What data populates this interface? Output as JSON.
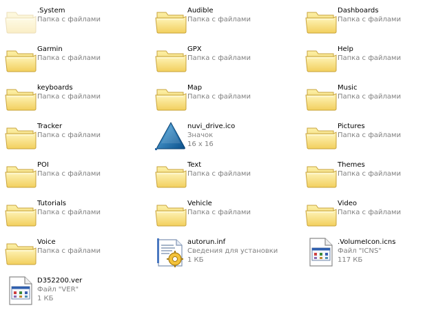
{
  "file_type_folder": "Папка с файлами",
  "items": [
    {
      "name": ".System",
      "icon": "folder-icon",
      "hidden": true,
      "lines": []
    },
    {
      "name": "Audible",
      "icon": "folder-icon",
      "lines": []
    },
    {
      "name": "Dashboards",
      "icon": "folder-icon",
      "lines": []
    },
    {
      "name": "Garmin",
      "icon": "folder-icon",
      "lines": []
    },
    {
      "name": "GPX",
      "icon": "folder-icon",
      "lines": []
    },
    {
      "name": "Help",
      "icon": "folder-icon",
      "lines": []
    },
    {
      "name": "keyboards",
      "icon": "folder-icon",
      "lines": []
    },
    {
      "name": "Map",
      "icon": "folder-icon",
      "lines": []
    },
    {
      "name": "Music",
      "icon": "folder-icon",
      "lines": []
    },
    {
      "name": "Tracker",
      "icon": "folder-icon",
      "lines": []
    },
    {
      "name": "nuvi_drive.ico",
      "icon": "garmin-triangle-icon",
      "lines": [
        "Значок",
        "16 x 16"
      ]
    },
    {
      "name": "Pictures",
      "icon": "folder-icon",
      "lines": []
    },
    {
      "name": "POI",
      "icon": "folder-icon",
      "lines": []
    },
    {
      "name": "Text",
      "icon": "folder-icon",
      "lines": []
    },
    {
      "name": "Themes",
      "icon": "folder-icon",
      "lines": []
    },
    {
      "name": "Tutorials",
      "icon": "folder-icon",
      "lines": []
    },
    {
      "name": "Vehicle",
      "icon": "folder-icon",
      "lines": []
    },
    {
      "name": "Video",
      "icon": "folder-icon",
      "lines": []
    },
    {
      "name": "Voice",
      "icon": "folder-icon",
      "lines": []
    },
    {
      "name": "autorun.inf",
      "icon": "setup-info-icon",
      "lines": [
        "Сведения для установки",
        "1 КБ"
      ]
    },
    {
      "name": ".VolumeIcon.icns",
      "icon": "generic-file-icon",
      "lines": [
        "Файл \"ICNS\"",
        "117 КБ"
      ]
    },
    {
      "name": "D352200.ver",
      "icon": "generic-file-icon",
      "lines": [
        "Файл \"VER\"",
        "1 КБ"
      ]
    }
  ]
}
